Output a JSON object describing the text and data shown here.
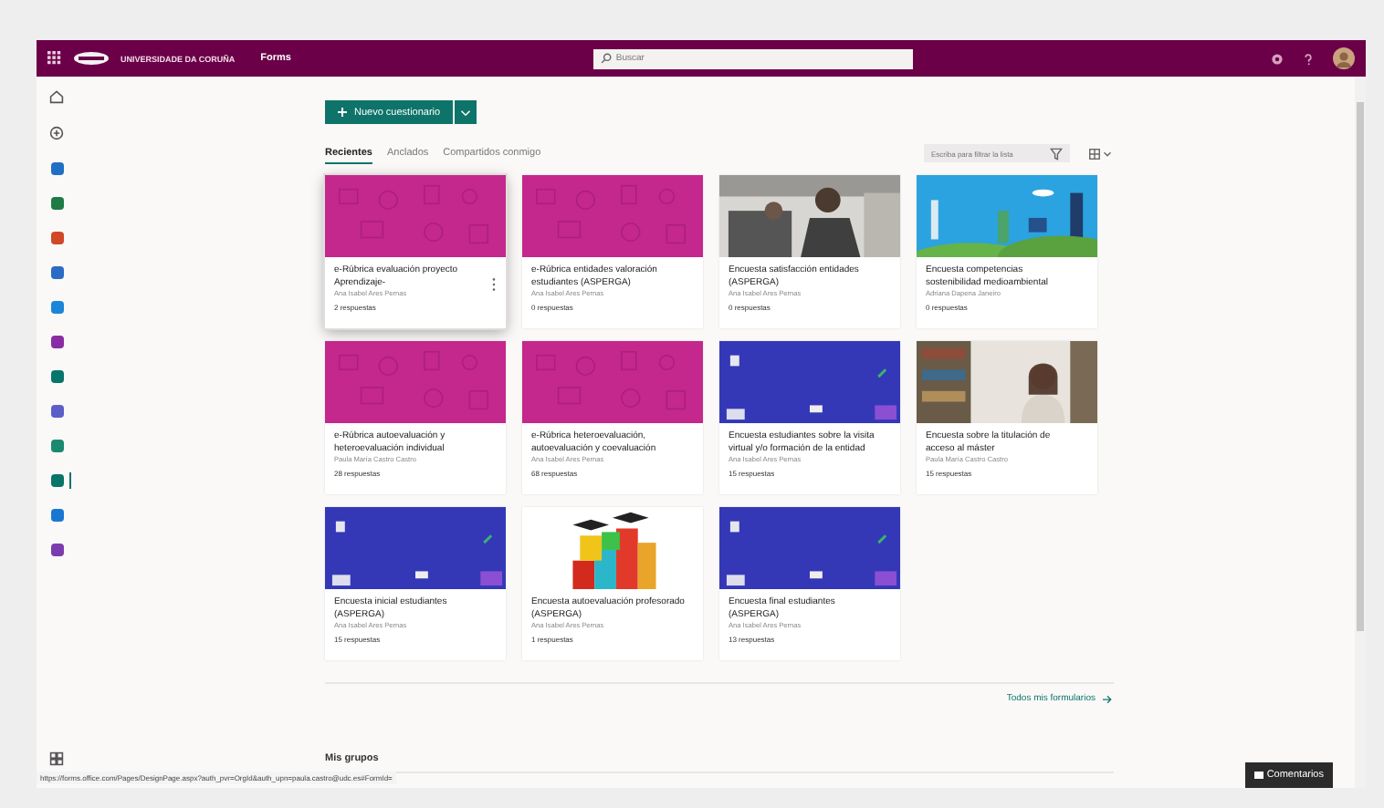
{
  "header": {
    "brand": "UNIVERSIDADE DA CORUÑA",
    "app": "Forms",
    "search_placeholder": "Buscar"
  },
  "rail": [
    {
      "kind": "home"
    },
    {
      "kind": "add"
    },
    {
      "kind": "app",
      "color": "#1f6fc5",
      "selected": false
    },
    {
      "kind": "app",
      "color": "#1e7b45",
      "selected": false
    },
    {
      "kind": "app",
      "color": "#d24726",
      "selected": false
    },
    {
      "kind": "app",
      "color": "#2b6cc4",
      "selected": false
    },
    {
      "kind": "app",
      "color": "#1a86d9",
      "selected": false
    },
    {
      "kind": "app",
      "color": "#8a2da5",
      "selected": false
    },
    {
      "kind": "app",
      "color": "#08756d",
      "selected": false
    },
    {
      "kind": "app",
      "color": "#5b5fc7",
      "selected": false
    },
    {
      "kind": "app",
      "color": "#1a8a6f",
      "selected": false
    },
    {
      "kind": "app",
      "color": "#077568",
      "selected": true
    },
    {
      "kind": "app",
      "color": "#1977d2",
      "selected": false
    },
    {
      "kind": "app",
      "color": "#7b3cb0",
      "selected": false
    }
  ],
  "new_button": "Nuevo cuestionario",
  "tabs": [
    {
      "label": "Recientes",
      "selected": true
    },
    {
      "label": "Anclados",
      "selected": false
    },
    {
      "label": "Compartidos conmigo",
      "selected": false
    }
  ],
  "filter_placeholder": "Escriba para filtrar la lista",
  "cards": [
    {
      "kind": "pattern",
      "title": "e-Rúbrica evaluación proyecto Aprendizaje-",
      "author": "Ana Isabel Ares Pernas",
      "responses": "2 respuestas",
      "focused": true
    },
    {
      "kind": "pattern",
      "title": "e-Rúbrica entidades valoración estudiantes (ASPERGA)",
      "author": "Ana Isabel Ares Pernas",
      "responses": "0 respuestas",
      "focused": false
    },
    {
      "title": "Encuesta satisfacción entidades (ASPERGA)",
      "author": "Ana Isabel Ares Pernas",
      "responses": "0 respuestas",
      "focused": false
    },
    {
      "kind": "city",
      "title": "Encuesta competencias sostenibilidad medioambiental",
      "author": "Adriana Dapena Janeiro",
      "responses": "0 respuestas",
      "focused": false
    },
    {
      "kind": "pattern",
      "title": "e-Rúbrica autoevaluación y heteroevaluación individual",
      "author": "Paula María Castro Castro",
      "responses": "28 respuestas",
      "focused": false
    },
    {
      "kind": "pattern",
      "title": "e-Rúbrica heteroevaluación, autoevaluación y coevaluación",
      "author": "Ana Isabel Ares Pernas",
      "responses": "68 respuestas",
      "focused": false
    },
    {
      "kind": "blue",
      "title": "Encuesta estudiantes sobre la visita virtual y/o formación de la entidad",
      "author": "Ana Isabel Ares Pernas",
      "responses": "15 respuestas",
      "focused": false
    },
    {
      "kind": "library",
      "title": "Encuesta sobre la titulación de acceso al máster",
      "author": "Paula María Castro Castro",
      "responses": "15 respuestas",
      "focused": false
    },
    {
      "kind": "blue",
      "title": "Encuesta inicial estudiantes (ASPERGA)",
      "author": "Ana Isabel Ares Pernas",
      "responses": "15 respuestas",
      "focused": false
    },
    {
      "kind": "blocks",
      "title": "Encuesta autoevaluación profesorado (ASPERGA)",
      "author": "Ana Isabel Ares Pernas",
      "responses": "1 respuestas",
      "focused": false
    },
    {
      "kind": "blue",
      "title": "Encuesta final estudiantes (ASPERGA)",
      "author": "Ana Isabel Ares Pernas",
      "responses": "13 respuestas",
      "focused": false
    }
  ],
  "all_forms_link": "Todos mis formularios",
  "groups_heading": "Mis grupos",
  "status_url": "https://forms.office.com/Pages/DesignPage.aspx?auth_pvr=OrgId&auth_upn=paula.castro@udc.es#FormId=",
  "feedback_button": "Comentarios"
}
